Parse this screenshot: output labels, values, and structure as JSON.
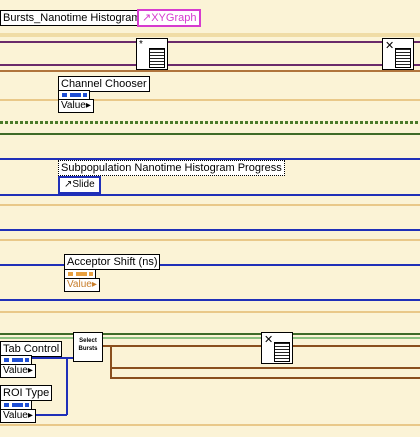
{
  "top": {
    "label": "Bursts_Nanotime Histogram",
    "graph_label": "XYGraph"
  },
  "channel": {
    "label": "Channel Chooser",
    "value": "Value"
  },
  "progress": {
    "label": "Subpopulation Nanotime Histogram Progress",
    "value": "Slide"
  },
  "acceptor": {
    "label": "Acceptor Shift (ns)",
    "value": "Value"
  },
  "tab": {
    "label": "Tab Control",
    "value": "Value"
  },
  "roi": {
    "label": "ROI Type",
    "value": "Value"
  },
  "select": {
    "line1": "Select",
    "line2": "Bursts"
  },
  "colors": {
    "bg": "#fbf3d6",
    "wire_orange": "#e8c37a",
    "wire_blue": "#1f2fb8",
    "wire_brown": "#8a4f1e",
    "graph_pink": "#d63bcf"
  },
  "icons": [
    "subvi-icon",
    "close-icon",
    "cluster-icon"
  ]
}
